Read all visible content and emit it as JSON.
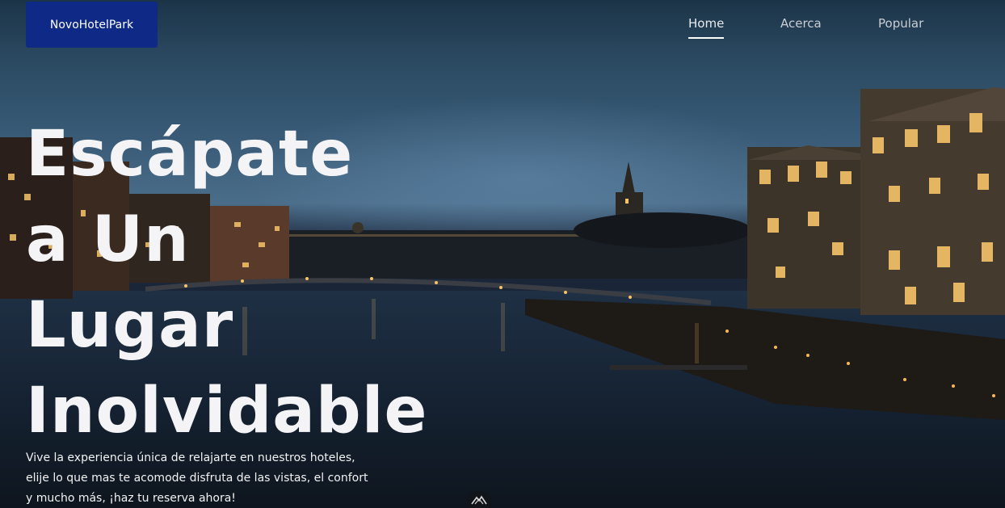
{
  "brand": {
    "name": "NovoHotelPark"
  },
  "nav": {
    "items": [
      {
        "label": "Home",
        "active": true
      },
      {
        "label": "Acerca",
        "active": false
      },
      {
        "label": "Popular",
        "active": false
      }
    ]
  },
  "hero": {
    "headline_lines": [
      "Escápate",
      "a Un",
      "Lugar",
      "Inolvidable"
    ],
    "tagline_lines": [
      "Vive la experiencia única de relajarte en nuestros hoteles,",
      "elije lo que mas te acomode disfruta de las vistas, el confort",
      "y mucho más, ¡haz tu reserva ahora!"
    ]
  },
  "colors": {
    "brand_bg": "#0f2a86",
    "text": "#f4f4f6",
    "sky": "#3a5c78",
    "lights": "#f6c46a"
  },
  "icons": {
    "scroll": "mountain-logo-icon"
  }
}
